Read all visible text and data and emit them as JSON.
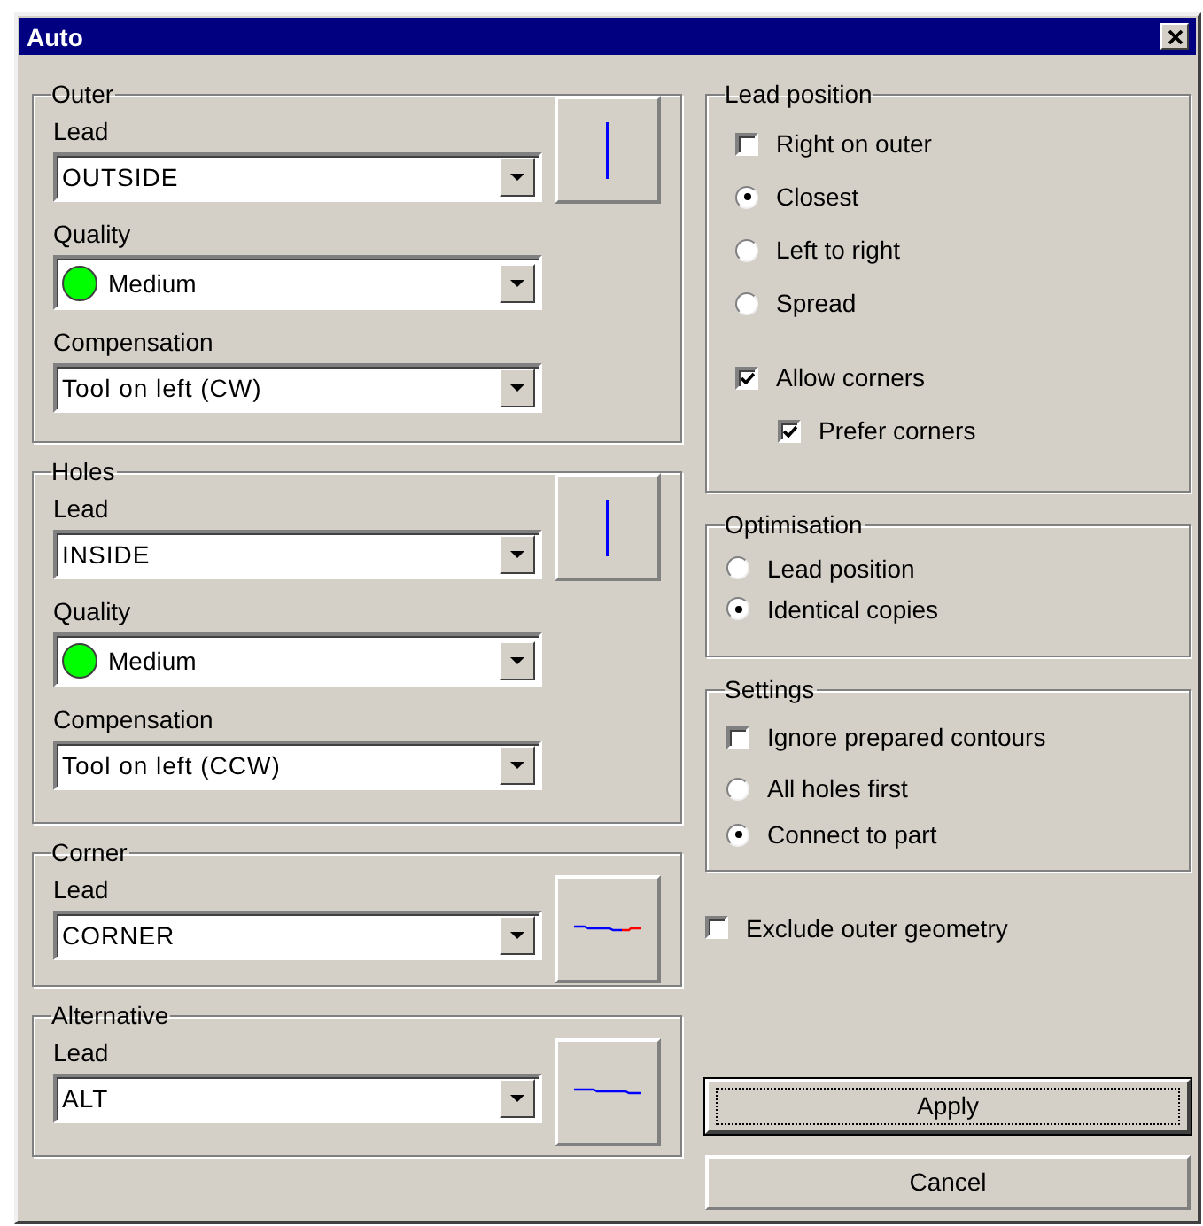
{
  "window": {
    "title": "Auto"
  },
  "lead_groups": [
    {
      "title": "Outer",
      "preview": {
        "kind": "vertical"
      },
      "fields": [
        {
          "label": "Lead",
          "value": "OUTSIDE"
        },
        {
          "label": "Quality",
          "value": "Medium",
          "color": "#00ff00"
        },
        {
          "label": "Compensation",
          "value": "Tool on left (CW)"
        }
      ]
    },
    {
      "title": "Holes",
      "preview": {
        "kind": "vertical"
      },
      "fields": [
        {
          "label": "Lead",
          "value": "INSIDE"
        },
        {
          "label": "Quality",
          "value": "Medium",
          "color": "#00ff00"
        },
        {
          "label": "Compensation",
          "value": "Tool on left (CCW)"
        }
      ]
    },
    {
      "title": "Corner",
      "preview": {
        "kind": "corner"
      },
      "fields": [
        {
          "label": "Lead",
          "value": "CORNER"
        }
      ]
    },
    {
      "title": "Alternative",
      "preview": {
        "kind": "step"
      },
      "fields": [
        {
          "label": "Lead",
          "value": "ALT"
        }
      ]
    }
  ],
  "lead_position": {
    "title": "Lead position",
    "options": [
      {
        "kind": "checkbox",
        "label": "Right on outer",
        "checked": false
      },
      {
        "kind": "radio",
        "label": "Closest",
        "selected": true
      },
      {
        "kind": "radio",
        "label": "Left to right",
        "selected": false
      },
      {
        "kind": "radio",
        "label": "Spread",
        "selected": false
      },
      {
        "kind": "checkbox",
        "label": "Allow corners",
        "checked": true,
        "children": [
          {
            "kind": "checkbox",
            "label": "Prefer corners",
            "checked": true
          }
        ]
      }
    ]
  },
  "optimisation": {
    "title": "Optimisation",
    "options": [
      {
        "kind": "radio",
        "label": "Lead position",
        "selected": false
      },
      {
        "kind": "radio",
        "label": "Identical copies",
        "selected": true
      }
    ]
  },
  "settings": {
    "title": "Settings",
    "options": [
      {
        "kind": "checkbox",
        "label": "Ignore prepared contours",
        "checked": false
      },
      {
        "kind": "radio",
        "label": "All holes first",
        "selected": false
      },
      {
        "kind": "radio",
        "label": "Connect to part",
        "selected": true
      }
    ]
  },
  "exclude_outer_geometry": {
    "label": "Exclude outer geometry",
    "checked": false
  },
  "buttons": [
    {
      "label": "Apply",
      "focused": true
    },
    {
      "label": "Cancel",
      "focused": false
    }
  ]
}
